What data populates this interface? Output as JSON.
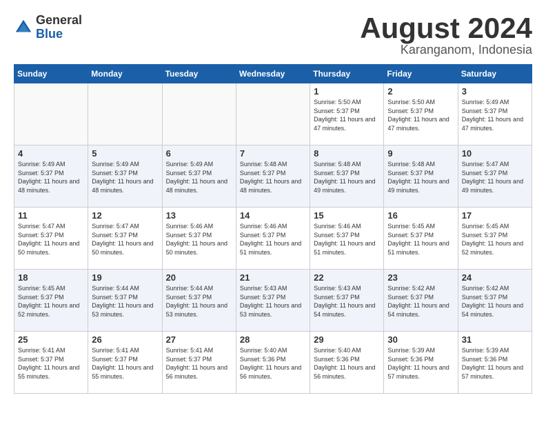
{
  "header": {
    "logo_general": "General",
    "logo_blue": "Blue",
    "title": "August 2024",
    "subtitle": "Karanganom, Indonesia"
  },
  "weekdays": [
    "Sunday",
    "Monday",
    "Tuesday",
    "Wednesday",
    "Thursday",
    "Friday",
    "Saturday"
  ],
  "weeks": [
    [
      {
        "day": "",
        "empty": true
      },
      {
        "day": "",
        "empty": true
      },
      {
        "day": "",
        "empty": true
      },
      {
        "day": "",
        "empty": true
      },
      {
        "day": "1",
        "sunrise": "5:50 AM",
        "sunset": "5:37 PM",
        "daylight": "11 hours and 47 minutes."
      },
      {
        "day": "2",
        "sunrise": "5:50 AM",
        "sunset": "5:37 PM",
        "daylight": "11 hours and 47 minutes."
      },
      {
        "day": "3",
        "sunrise": "5:49 AM",
        "sunset": "5:37 PM",
        "daylight": "11 hours and 47 minutes."
      }
    ],
    [
      {
        "day": "4",
        "sunrise": "5:49 AM",
        "sunset": "5:37 PM",
        "daylight": "11 hours and 48 minutes."
      },
      {
        "day": "5",
        "sunrise": "5:49 AM",
        "sunset": "5:37 PM",
        "daylight": "11 hours and 48 minutes."
      },
      {
        "day": "6",
        "sunrise": "5:49 AM",
        "sunset": "5:37 PM",
        "daylight": "11 hours and 48 minutes."
      },
      {
        "day": "7",
        "sunrise": "5:48 AM",
        "sunset": "5:37 PM",
        "daylight": "11 hours and 48 minutes."
      },
      {
        "day": "8",
        "sunrise": "5:48 AM",
        "sunset": "5:37 PM",
        "daylight": "11 hours and 49 minutes."
      },
      {
        "day": "9",
        "sunrise": "5:48 AM",
        "sunset": "5:37 PM",
        "daylight": "11 hours and 49 minutes."
      },
      {
        "day": "10",
        "sunrise": "5:47 AM",
        "sunset": "5:37 PM",
        "daylight": "11 hours and 49 minutes."
      }
    ],
    [
      {
        "day": "11",
        "sunrise": "5:47 AM",
        "sunset": "5:37 PM",
        "daylight": "11 hours and 50 minutes."
      },
      {
        "day": "12",
        "sunrise": "5:47 AM",
        "sunset": "5:37 PM",
        "daylight": "11 hours and 50 minutes."
      },
      {
        "day": "13",
        "sunrise": "5:46 AM",
        "sunset": "5:37 PM",
        "daylight": "11 hours and 50 minutes."
      },
      {
        "day": "14",
        "sunrise": "5:46 AM",
        "sunset": "5:37 PM",
        "daylight": "11 hours and 51 minutes."
      },
      {
        "day": "15",
        "sunrise": "5:46 AM",
        "sunset": "5:37 PM",
        "daylight": "11 hours and 51 minutes."
      },
      {
        "day": "16",
        "sunrise": "5:45 AM",
        "sunset": "5:37 PM",
        "daylight": "11 hours and 51 minutes."
      },
      {
        "day": "17",
        "sunrise": "5:45 AM",
        "sunset": "5:37 PM",
        "daylight": "11 hours and 52 minutes."
      }
    ],
    [
      {
        "day": "18",
        "sunrise": "5:45 AM",
        "sunset": "5:37 PM",
        "daylight": "11 hours and 52 minutes."
      },
      {
        "day": "19",
        "sunrise": "5:44 AM",
        "sunset": "5:37 PM",
        "daylight": "11 hours and 53 minutes."
      },
      {
        "day": "20",
        "sunrise": "5:44 AM",
        "sunset": "5:37 PM",
        "daylight": "11 hours and 53 minutes."
      },
      {
        "day": "21",
        "sunrise": "5:43 AM",
        "sunset": "5:37 PM",
        "daylight": "11 hours and 53 minutes."
      },
      {
        "day": "22",
        "sunrise": "5:43 AM",
        "sunset": "5:37 PM",
        "daylight": "11 hours and 54 minutes."
      },
      {
        "day": "23",
        "sunrise": "5:42 AM",
        "sunset": "5:37 PM",
        "daylight": "11 hours and 54 minutes."
      },
      {
        "day": "24",
        "sunrise": "5:42 AM",
        "sunset": "5:37 PM",
        "daylight": "11 hours and 54 minutes."
      }
    ],
    [
      {
        "day": "25",
        "sunrise": "5:41 AM",
        "sunset": "5:37 PM",
        "daylight": "11 hours and 55 minutes."
      },
      {
        "day": "26",
        "sunrise": "5:41 AM",
        "sunset": "5:37 PM",
        "daylight": "11 hours and 55 minutes."
      },
      {
        "day": "27",
        "sunrise": "5:41 AM",
        "sunset": "5:37 PM",
        "daylight": "11 hours and 56 minutes."
      },
      {
        "day": "28",
        "sunrise": "5:40 AM",
        "sunset": "5:36 PM",
        "daylight": "11 hours and 56 minutes."
      },
      {
        "day": "29",
        "sunrise": "5:40 AM",
        "sunset": "5:36 PM",
        "daylight": "11 hours and 56 minutes."
      },
      {
        "day": "30",
        "sunrise": "5:39 AM",
        "sunset": "5:36 PM",
        "daylight": "11 hours and 57 minutes."
      },
      {
        "day": "31",
        "sunrise": "5:39 AM",
        "sunset": "5:36 PM",
        "daylight": "11 hours and 57 minutes."
      }
    ]
  ],
  "labels": {
    "sunrise": "Sunrise:",
    "sunset": "Sunset:",
    "daylight": "Daylight:"
  }
}
